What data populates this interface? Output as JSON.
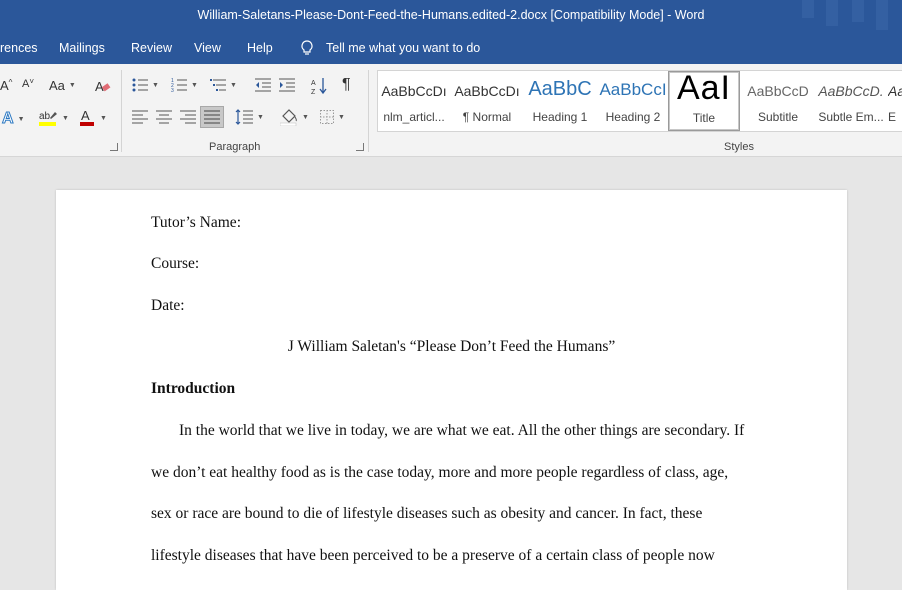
{
  "window": {
    "title": "William-Saletans-Please-Dont-Feed-the-Humans.edited-2.docx [Compatibility Mode]  -  Word"
  },
  "tabs": {
    "references_partial": "rences",
    "mailings": "Mailings",
    "review": "Review",
    "view": "View",
    "help": "Help",
    "tell_me": "Tell me what you want to do"
  },
  "ribbon": {
    "font_group": {
      "grow_font": "A",
      "shrink_font": "A",
      "change_case": "Aa",
      "text_effects": "A",
      "font_color": "A",
      "accent_color": "#c00000",
      "highlight_color": "#ffff00"
    },
    "paragraph": {
      "label": "Paragraph",
      "show_marks": "¶"
    },
    "styles": {
      "label": "Styles",
      "items": [
        {
          "preview": "AaBbCcDı",
          "name": "nlm_articl..."
        },
        {
          "preview": "AaBbCcDı",
          "name": "¶ Normal"
        },
        {
          "preview": "AaBbC",
          "name": "Heading 1"
        },
        {
          "preview": "AaBbCcI",
          "name": "Heading 2"
        },
        {
          "preview": "AaI",
          "name": "Title"
        },
        {
          "preview": "AaBbCcD",
          "name": "Subtitle"
        },
        {
          "preview": "AaBbCcD.",
          "name": "Subtle Em..."
        },
        {
          "preview": "Aa",
          "name": "E"
        }
      ]
    }
  },
  "document": {
    "tutor": "Tutor’s Name:",
    "course": "Course:",
    "date": "Date:",
    "title": "J William Saletan's “Please Don’t Feed the Humans”",
    "heading": "Introduction",
    "para_lines": [
      "In the world that we live in today, we are what we eat. All the other things are secondary. If",
      "we don’t eat healthy food as is the case today, more and more people regardless of class, age,",
      "sex or race are bound to die of lifestyle diseases such as obesity and cancer. In fact, these",
      "lifestyle diseases that have been perceived to be a preserve of a certain class of people now"
    ]
  }
}
